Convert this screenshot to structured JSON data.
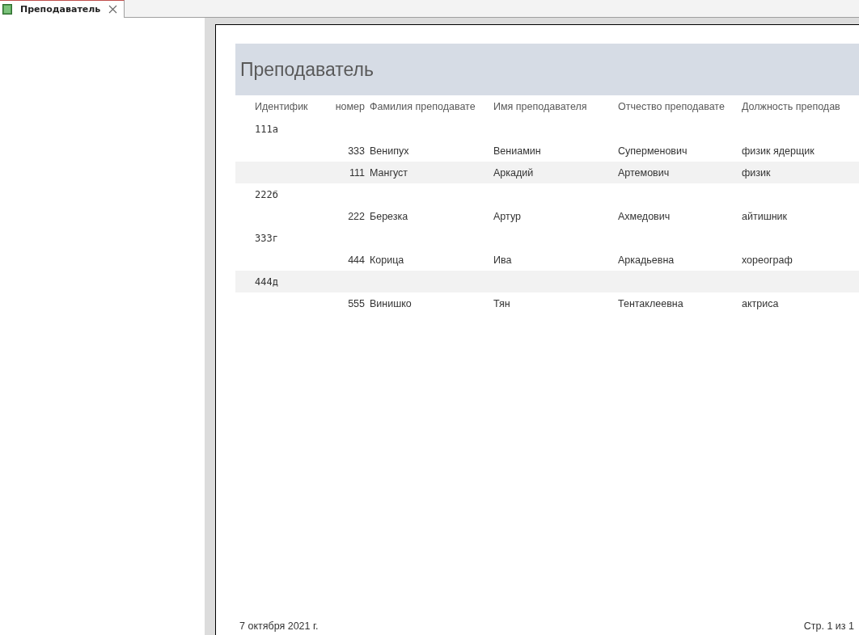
{
  "tab": {
    "label": "Преподаватель",
    "selected": true
  },
  "report": {
    "title": "Преподаватель",
    "columns": [
      "Идентифик",
      "номер",
      "Фамилия преподавате",
      "Имя преподавателя",
      "Отчество преподавате",
      "Должность преподав"
    ],
    "rows": [
      {
        "kind": "group",
        "shaded": false,
        "id": "111а"
      },
      {
        "kind": "detail",
        "shaded": false,
        "cells": [
          "333",
          "Венипух",
          "Вениамин",
          "Суперменович",
          "физик ядерщик"
        ]
      },
      {
        "kind": "detail",
        "shaded": true,
        "cells": [
          "111",
          "Мангуст",
          "Аркадий",
          "Артемович",
          "физик"
        ]
      },
      {
        "kind": "group",
        "shaded": false,
        "id": "222б"
      },
      {
        "kind": "detail",
        "shaded": false,
        "cells": [
          "222",
          "Березка",
          "Артур",
          "Ахмедович",
          "айтишник"
        ]
      },
      {
        "kind": "group",
        "shaded": false,
        "id": "333г"
      },
      {
        "kind": "detail",
        "shaded": false,
        "cells": [
          "444",
          "Корица",
          "Ива",
          "Аркадьевна",
          "хореограф"
        ]
      },
      {
        "kind": "group",
        "shaded": true,
        "id": "444д"
      },
      {
        "kind": "detail",
        "shaded": false,
        "cells": [
          "555",
          "Винишко",
          "Тян",
          "Тентаклеевна",
          "актриса"
        ]
      }
    ],
    "footer_date": "7 октября 2021 г.",
    "footer_page": "Стр. 1 из 1"
  }
}
